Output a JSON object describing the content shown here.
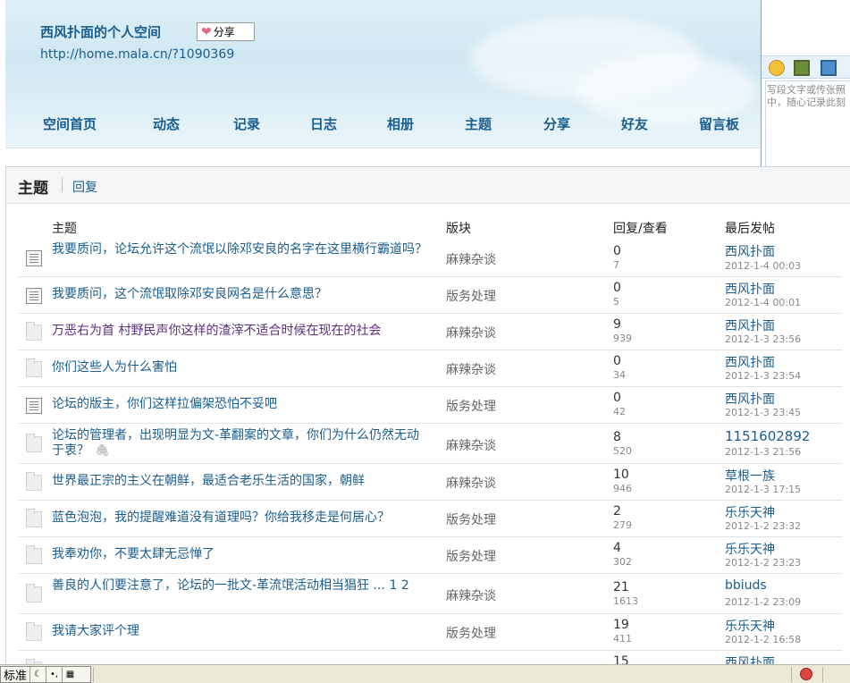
{
  "header": {
    "title": "西风扑面的个人空间",
    "share_label": "分享",
    "url": "http://home.mala.cn/?1090369",
    "nav": [
      "空间首页",
      "动态",
      "记录",
      "日志",
      "相册",
      "主题",
      "分享",
      "好友",
      "留言板"
    ]
  },
  "side_panel": {
    "placeholder_line1": "写段文字或传张照",
    "placeholder_line2": "中，随心记录此刻"
  },
  "content": {
    "tab_topic": "主题",
    "tab_reply": "回复",
    "columns": {
      "title": "主题",
      "forum": "版块",
      "stats": "回复/查看",
      "last": "最后发帖"
    },
    "rows": [
      {
        "icon": "doc-icon",
        "title": "我要质问，论坛允许这个流氓以除邓安良的名字在这里横行霸道吗？",
        "forum": "麻辣杂谈",
        "replies": "0",
        "views": "7",
        "author": "西风扑面",
        "time": "2012-1-4 00:03"
      },
      {
        "icon": "doc-icon",
        "title": "我要质问，这个流氓取除邓安良网名是什么意思？",
        "forum": "版务处理",
        "replies": "0",
        "views": "5",
        "author": "西风扑面",
        "time": "2012-1-4 00:01"
      },
      {
        "icon": "folder-icon",
        "title": "万恶右为首 村野民声你这样的渣滓不适合时候在现在的社会",
        "forum": "麻辣杂谈",
        "replies": "9",
        "views": "939",
        "author": "西风扑面",
        "time": "2012-1-3 23:56"
      },
      {
        "icon": "folder-icon",
        "title": "你们这些人为什么害怕",
        "forum": "麻辣杂谈",
        "replies": "0",
        "views": "34",
        "author": "西风扑面",
        "time": "2012-1-3 23:54"
      },
      {
        "icon": "doc-icon",
        "title": "论坛的版主，你们这样拉偏架恐怕不妥吧",
        "forum": "版务处理",
        "replies": "0",
        "views": "42",
        "author": "西风扑面",
        "time": "2012-1-3 23:45"
      },
      {
        "icon": "folder-icon",
        "title": "论坛的管理者，出现明显为文-革翻案的文章，你们为什么仍然无动于衷？",
        "forum": "麻辣杂谈",
        "replies": "8",
        "views": "520",
        "author": "1151602892",
        "time": "2012-1-3 21:56"
      },
      {
        "icon": "folder-icon",
        "title": "世界最正宗的主义在朝鲜，最适合老乐生活的国家，朝鲜",
        "forum": "麻辣杂谈",
        "replies": "10",
        "views": "946",
        "author": "草根一族",
        "time": "2012-1-3 17:15"
      },
      {
        "icon": "folder-icon",
        "title": "蓝色泡泡，我的提醒难道没有道理吗？你给我移走是何居心？",
        "forum": "版务处理",
        "replies": "2",
        "views": "279",
        "author": "乐乐天神",
        "time": "2012-1-2 23:32"
      },
      {
        "icon": "folder-icon",
        "title": "我奉劝你，不要太肆无忌惮了",
        "forum": "版务处理",
        "replies": "4",
        "views": "302",
        "author": "乐乐天神",
        "time": "2012-1-2 23:23"
      },
      {
        "icon": "folder-icon",
        "title": "善良的人们要注意了，论坛的一批文-革流氓活动相当猖狂",
        "pages": "… 1 2",
        "forum": "麻辣杂谈",
        "replies": "21",
        "views": "1613",
        "author": "bbiuds",
        "time": "2012-1-2 23:09"
      },
      {
        "icon": "folder-icon",
        "title": "我请大家评个理",
        "forum": "版务处理",
        "replies": "19",
        "views": "411",
        "author": "乐乐天神",
        "time": "2012-1-2 16:58"
      },
      {
        "icon": "folder-icon",
        "title": "",
        "forum": "",
        "replies": "15",
        "views": "",
        "author": "西风扑面",
        "time": ""
      }
    ]
  },
  "statusbar": {
    "ime_label": "标准"
  }
}
